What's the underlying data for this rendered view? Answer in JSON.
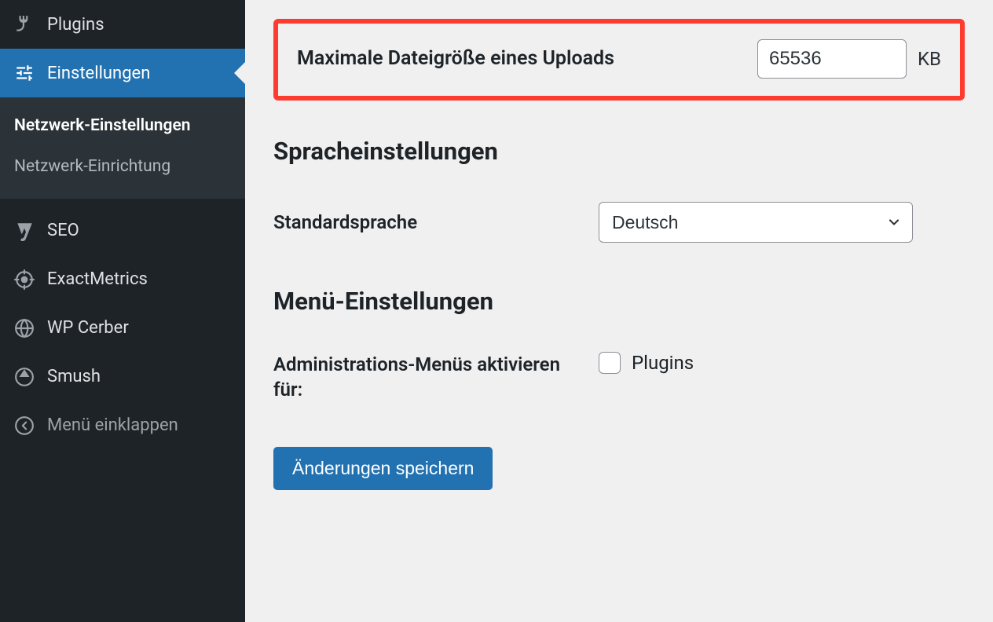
{
  "sidebar": {
    "items": [
      {
        "label": "Plugins"
      },
      {
        "label": "Einstellungen"
      }
    ],
    "submenu": [
      {
        "label": "Netzwerk-Einstellungen"
      },
      {
        "label": "Netzwerk-Einrichtung"
      }
    ],
    "extra": [
      {
        "label": "SEO"
      },
      {
        "label": "ExactMetrics"
      },
      {
        "label": "WP Cerber"
      },
      {
        "label": "Smush"
      }
    ],
    "collapse_label": "Menü einklappen"
  },
  "content": {
    "max_upload": {
      "label": "Maximale Dateigröße eines Uploads",
      "value": "65536",
      "unit": "KB"
    },
    "language": {
      "heading": "Spracheinstellungen",
      "label": "Standardsprache",
      "selected": "Deutsch"
    },
    "menu": {
      "heading": "Menü-Einstellungen",
      "label": "Administrations-Menüs aktivieren für:",
      "checkbox_label": "Plugins"
    },
    "save_button": "Änderungen speichern"
  }
}
